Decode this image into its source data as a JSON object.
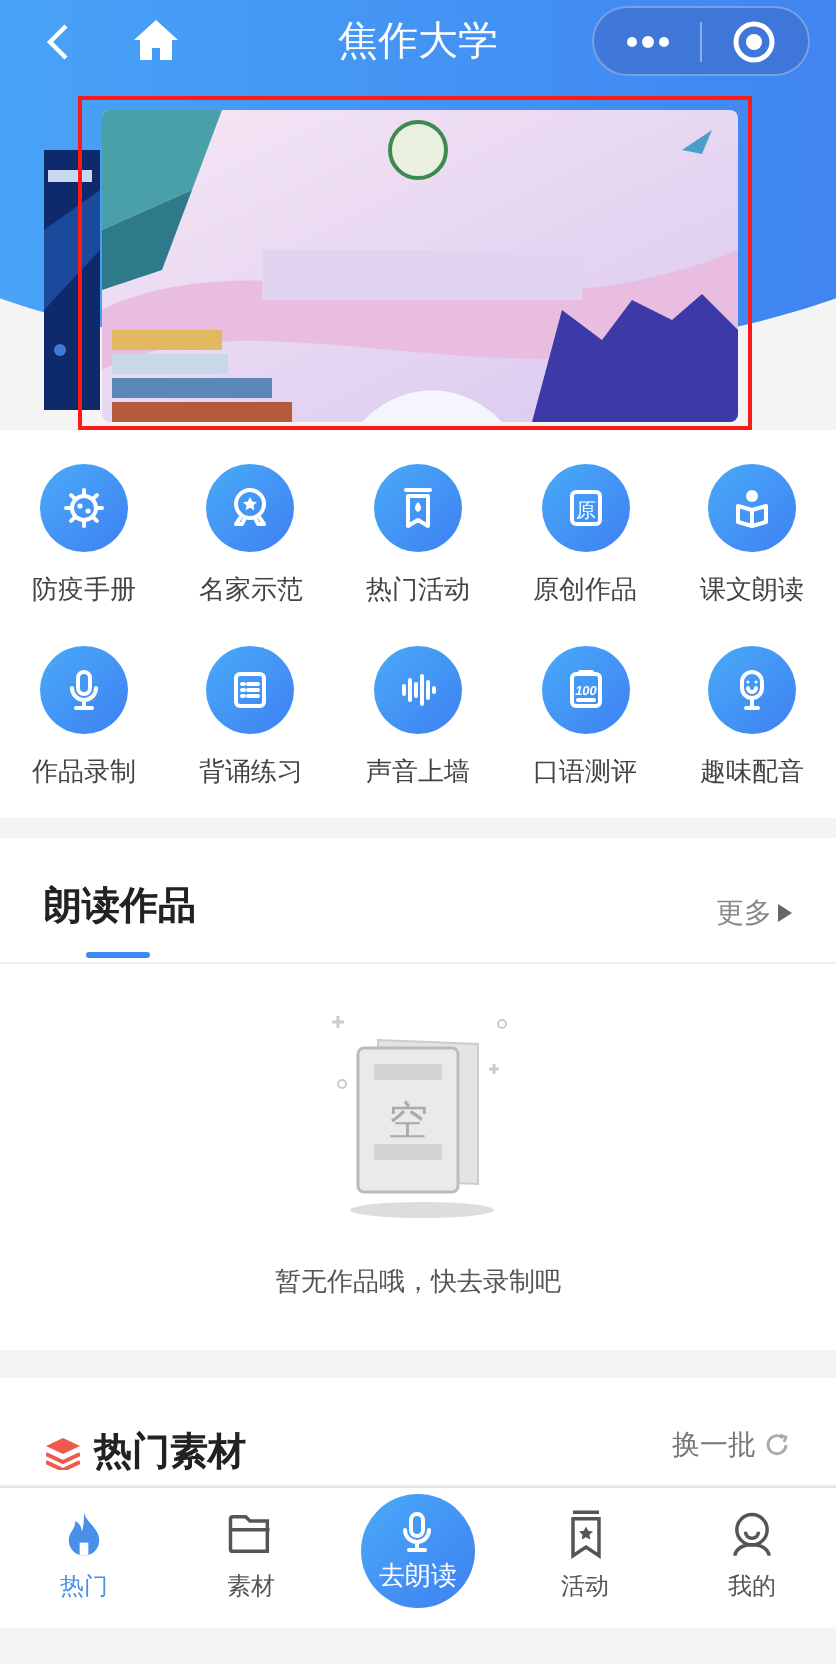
{
  "nav_bar": {
    "title": "焦作大学"
  },
  "banner": {
    "highlighted": true
  },
  "shortcuts": [
    {
      "label": "防疫手册",
      "kind": "virus"
    },
    {
      "label": "名家示范",
      "kind": "medal"
    },
    {
      "label": "热门活动",
      "kind": "bookmark"
    },
    {
      "label": "原创作品",
      "kind": "glyph",
      "glyph": "原"
    },
    {
      "label": "课文朗读",
      "kind": "reader"
    },
    {
      "label": "作品录制",
      "kind": "mic"
    },
    {
      "label": "背诵练习",
      "kind": "list"
    },
    {
      "label": "声音上墙",
      "kind": "wave"
    },
    {
      "label": "口语测评",
      "kind": "score",
      "glyph": "100"
    },
    {
      "label": "趣味配音",
      "kind": "dubbing"
    }
  ],
  "works_section": {
    "title": "朗读作品",
    "more": "更多",
    "empty_glyph": "空",
    "empty_text": "暂无作品哦，快去录制吧"
  },
  "materials_section": {
    "title": "热门素材",
    "refresh": "换一批"
  },
  "tab_bar": [
    {
      "label": "热门",
      "kind": "tab",
      "selected": true
    },
    {
      "label": "素材",
      "kind": "tab",
      "selected": false
    },
    {
      "label": "去朗读",
      "kind": "center",
      "selected": false
    },
    {
      "label": "活动",
      "kind": "tab",
      "selected": false
    },
    {
      "label": "我的",
      "kind": "tab",
      "selected": false
    }
  ]
}
